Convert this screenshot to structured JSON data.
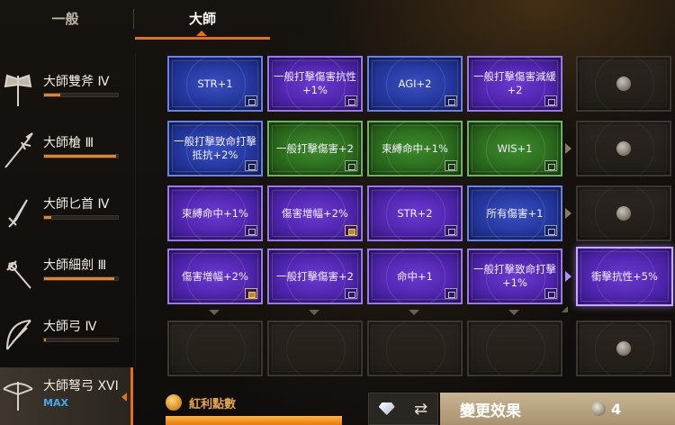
{
  "tabs": {
    "general": "一般",
    "master": "大師"
  },
  "weapons": [
    {
      "name": "大師雙斧 Ⅳ",
      "icon": "double-axe-icon",
      "progress": 0.22
    },
    {
      "name": "大師槍 Ⅲ",
      "icon": "spear-icon",
      "progress": 0.98
    },
    {
      "name": "大師匕首 Ⅳ",
      "icon": "dagger-icon",
      "progress": 0.1
    },
    {
      "name": "大師細劍 Ⅲ",
      "icon": "rapier-icon",
      "progress": 0.95
    },
    {
      "name": "大師弓 Ⅳ",
      "icon": "bow-icon",
      "progress": 0.02
    },
    {
      "name": "大師弩弓 XVI",
      "icon": "crossbow-icon",
      "max_label": "MAX"
    }
  ],
  "grid": {
    "rows": [
      [
        {
          "label": "STR+1",
          "color": "blue",
          "lock": true
        },
        {
          "label": "一般打擊傷害抗性+1%",
          "color": "purple",
          "lock": true
        },
        {
          "label": "AGI+2",
          "color": "blue",
          "lock": true
        },
        {
          "label": "一般打擊傷害減緩+2",
          "color": "purple",
          "lock": true
        }
      ],
      [
        {
          "label": "一般打擊致命打擊抵抗+2%",
          "color": "blue",
          "lock": true
        },
        {
          "label": "一般打擊傷害+2",
          "color": "green",
          "lock": true
        },
        {
          "label": "束縛命中+1%",
          "color": "green",
          "lock": true
        },
        {
          "label": "WIS+1",
          "color": "green",
          "lock": true
        }
      ],
      [
        {
          "label": "束縛命中+1%",
          "color": "purple",
          "lock": true
        },
        {
          "label": "傷害增幅+2%",
          "color": "purple",
          "lock": true,
          "gold": true
        },
        {
          "label": "STR+2",
          "color": "purple",
          "lock": true
        },
        {
          "label": "所有傷害+1",
          "color": "blue",
          "lock": true
        }
      ],
      [
        {
          "label": "傷害增幅+2%",
          "color": "purple",
          "lock": true,
          "gold": true
        },
        {
          "label": "一般打擊傷害+2",
          "color": "purple",
          "lock": true
        },
        {
          "label": "命中+1",
          "color": "purple",
          "lock": true
        },
        {
          "label": "一般打擊致命打擊+1%",
          "color": "purple",
          "lock": true
        }
      ]
    ],
    "extra_card": {
      "label": "衝擊抗性+5%",
      "color": "purple"
    }
  },
  "bonus": {
    "label": "紅利點數",
    "progress": 1.0
  },
  "apply": {
    "label": "變更效果",
    "cost": "4"
  },
  "colors": {
    "accent": "#e36f16",
    "max_blue": "#44a8ea",
    "bonus_gold": "#e8a64a"
  }
}
